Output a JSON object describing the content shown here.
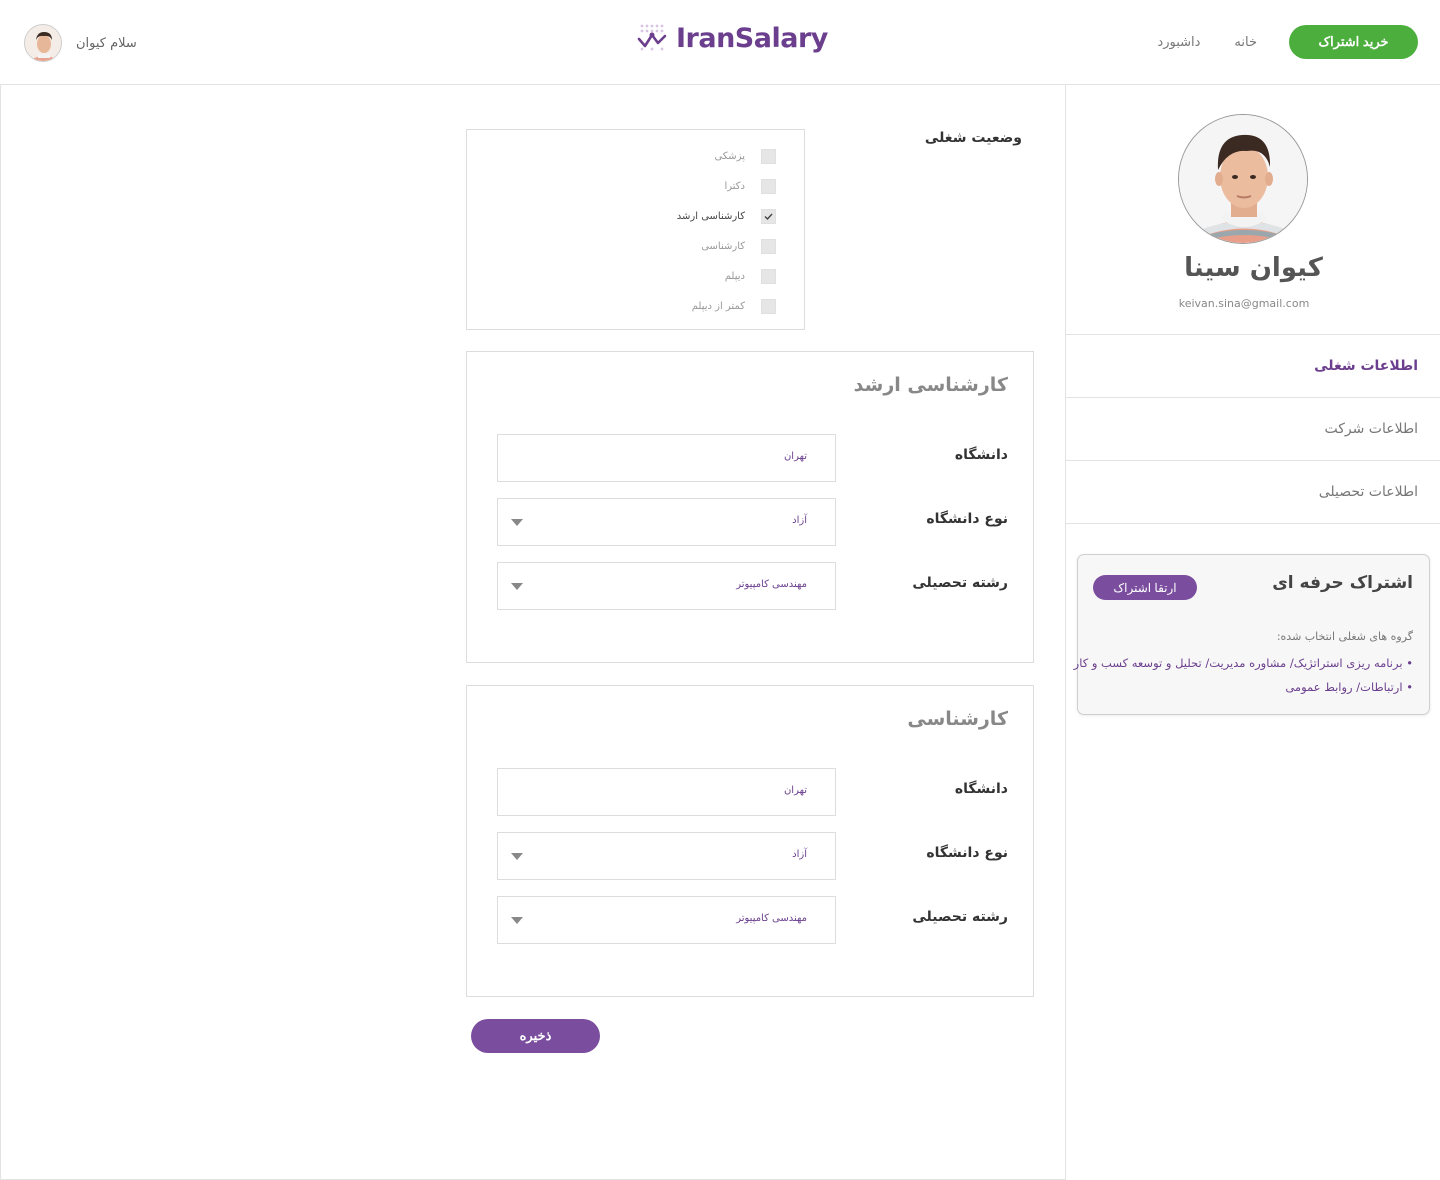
{
  "header": {
    "greeting": "سلام کیوان",
    "logo_text": "IranSalary",
    "nav": {
      "buy_label": "خرید اشتراک",
      "home_label": "خانه",
      "dashboard_label": "داشبورد"
    }
  },
  "profile": {
    "name": "کیوان سینا",
    "email": "keivan.sina@gmail.com"
  },
  "sidebar_menu": [
    {
      "label": "اطلاعات شغلی",
      "active": true
    },
    {
      "label": "اطلاعات شرکت",
      "active": false
    },
    {
      "label": "اطلاعات تحصیلی",
      "active": false
    }
  ],
  "subscription": {
    "title": "اشتراک حرفه ای",
    "upgrade_label": "ارتقا اشتراک",
    "subtitle": "گروه های شغلی انتخاب شده:",
    "items": [
      "• برنامه ریزی استراتژیک/ مشاوره مدیریت/ تحلیل و توسعه کسب و کار",
      "• ارتباطات/ روابط عمومی"
    ]
  },
  "job_status": {
    "label": "وضعیت شغلی",
    "options": [
      {
        "label": "پزشکی",
        "checked": false
      },
      {
        "label": "دکترا",
        "checked": false
      },
      {
        "label": "کارشناسی ارشد",
        "checked": true
      },
      {
        "label": "کارشناسی",
        "checked": false
      },
      {
        "label": "دیپلم",
        "checked": false
      },
      {
        "label": "کمتر از دیپلم",
        "checked": false
      }
    ]
  },
  "education_sections": [
    {
      "title": "کارشناسی ارشد",
      "university_label": "دانشگاه",
      "university_value": "تهران",
      "type_label": "نوع دانشگاه",
      "type_value": "آزاد",
      "major_label": "رشته تحصیلی",
      "major_value": "مهندسی کامپیوتر"
    },
    {
      "title": "کارشناسی",
      "university_label": "دانشگاه",
      "university_value": "تهران",
      "type_label": "نوع دانشگاه",
      "type_value": "آزاد",
      "major_label": "رشته تحصیلی",
      "major_value": "مهندسی کامپیوتر"
    }
  ],
  "save_label": "ذخیره",
  "colors": {
    "brand_purple": "#6b3f8e",
    "button_purple": "#7a4d9e",
    "buy_green": "#4caf3d"
  }
}
